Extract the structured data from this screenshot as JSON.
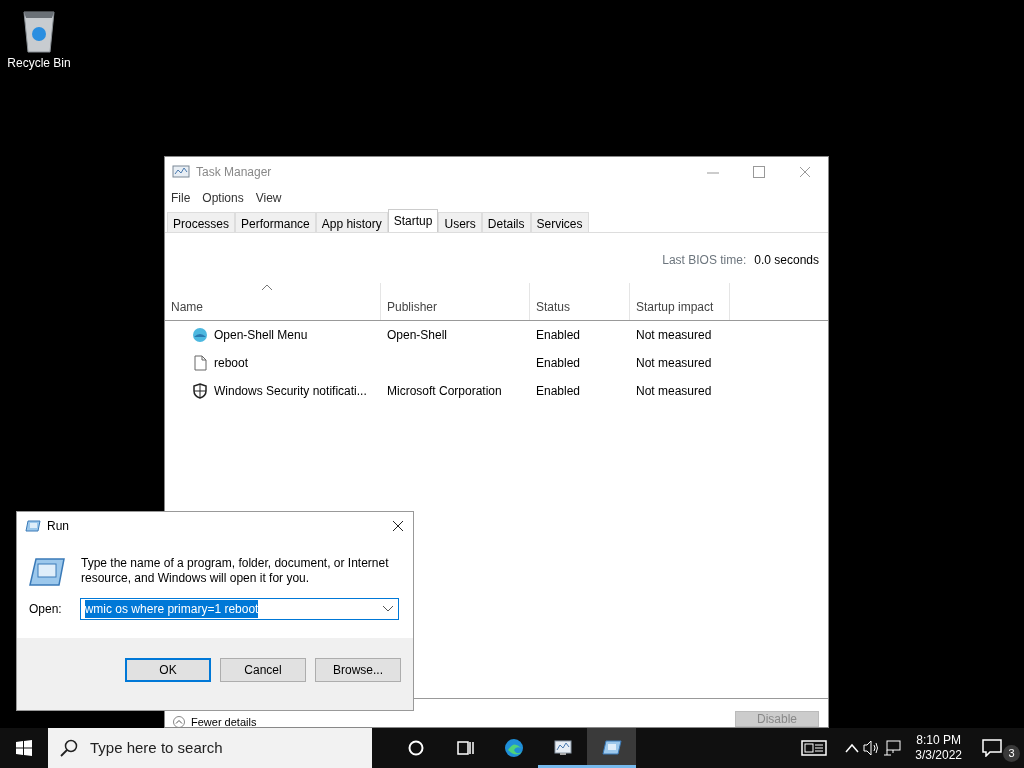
{
  "desktop_icons": [
    {
      "label": "Recycle Bin"
    }
  ],
  "task_manager": {
    "title": "Task Manager",
    "menu": [
      "File",
      "Options",
      "View"
    ],
    "tabs": [
      {
        "label": "Processes",
        "selected": false
      },
      {
        "label": "Performance",
        "selected": false
      },
      {
        "label": "App history",
        "selected": false
      },
      {
        "label": "Startup",
        "selected": true
      },
      {
        "label": "Users",
        "selected": false
      },
      {
        "label": "Details",
        "selected": false
      },
      {
        "label": "Services",
        "selected": false
      }
    ],
    "bios_label": "Last BIOS time:",
    "bios_value": "0.0 seconds",
    "columns": [
      {
        "label": "Name",
        "sorted": true
      },
      {
        "label": "Publisher",
        "sorted": false
      },
      {
        "label": "Status",
        "sorted": false
      },
      {
        "label": "Startup impact",
        "sorted": false
      }
    ],
    "rows": [
      {
        "kind": "shell",
        "name": "Open-Shell Menu",
        "publisher": "Open-Shell",
        "status": "Enabled",
        "impact": "Not measured"
      },
      {
        "kind": "file",
        "name": "reboot",
        "publisher": "",
        "status": "Enabled",
        "impact": "Not measured"
      },
      {
        "kind": "shield",
        "name": "Windows Security notificati...",
        "publisher": "Microsoft Corporation",
        "status": "Enabled",
        "impact": "Not measured"
      }
    ],
    "fewer_details": "Fewer details",
    "disable_button": {
      "label": "Disable",
      "disabled": true
    }
  },
  "run_dialog": {
    "title": "Run",
    "description": "Type the name of a program, folder, document, or Internet resource, and Windows will open it for you.",
    "open_label": "Open:",
    "value": "wmic os where primary=1 reboot",
    "value_selected": true,
    "buttons": [
      {
        "label": "OK",
        "default": true
      },
      {
        "label": "Cancel",
        "default": false
      },
      {
        "label": "Browse...",
        "default": false
      }
    ]
  },
  "taskbar": {
    "search_placeholder": "Type here to search",
    "apps": [
      {
        "kind": "cortana",
        "running": false,
        "selected": false
      },
      {
        "kind": "taskview",
        "running": false,
        "selected": false
      },
      {
        "kind": "edge",
        "running": false,
        "selected": false
      },
      {
        "kind": "taskmanager",
        "running": true,
        "selected": false
      },
      {
        "kind": "run",
        "running": true,
        "selected": true
      }
    ],
    "time": "8:10 PM",
    "date": "3/3/2022",
    "notification_count": "3"
  }
}
